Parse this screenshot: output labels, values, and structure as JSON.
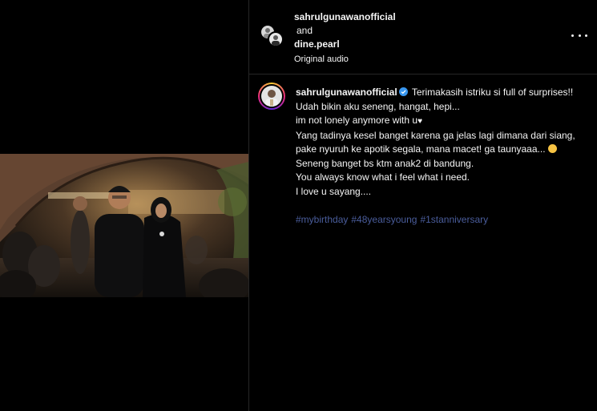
{
  "header": {
    "user1": "sahrulgunawanofficial",
    "and_text": "and",
    "user2": "dine.pearl",
    "audio": "Original audio"
  },
  "caption": {
    "username": "sahrulgunawanofficial",
    "first_line": "Terimakasih istriku si full of surprises!!",
    "lines": [
      "Udah bikin aku seneng, hangat, hepi...",
      "im not lonely anymore with u",
      "Yang tadinya kesel banget karena ga jelas lagi dimana dari siang,",
      "pake nyuruh ke apotik segala, mana macet! ga taunyaaa...",
      "Seneng banget bs ktm anak2 di bandung.",
      "You always know what i feel what i need.",
      "I love u sayang...."
    ],
    "heart": "♥",
    "hashtags": [
      "#mybirthday",
      "#48yearsyoung",
      "#1stanniversary"
    ]
  },
  "icons": {
    "verified": "verified-badge-icon",
    "more": "more-options-icon",
    "emoji": "smiling-face-emoji"
  },
  "colors": {
    "background": "#000000",
    "divider": "#262626",
    "hashtag": "#4a5d9c",
    "verified": "#3897f0"
  }
}
